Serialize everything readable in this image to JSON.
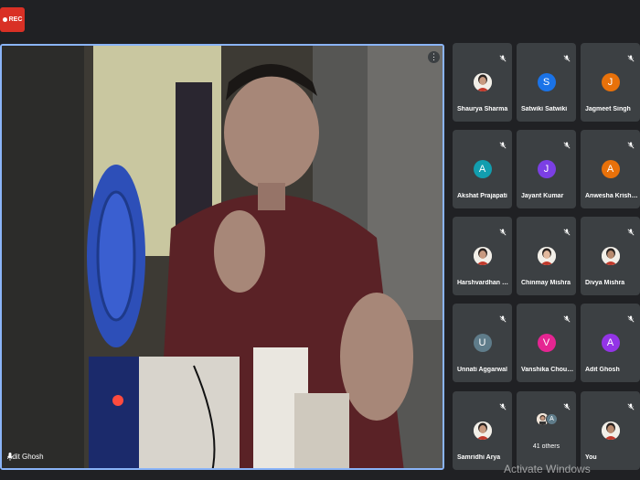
{
  "recording": {
    "label": "REC"
  },
  "main_video": {
    "name": "Adit Ghosh",
    "more_symbol": "⋮"
  },
  "participants": [
    {
      "name": "Shaurya Sharma",
      "initial": "",
      "avatar_color": "",
      "photo": true
    },
    {
      "name": "Satwiki Satwiki",
      "initial": "S",
      "avatar_color": "#1a73e8",
      "photo": false
    },
    {
      "name": "Jagmeet Singh",
      "initial": "J",
      "avatar_color": "#e8710a",
      "photo": false
    },
    {
      "name": "Akshat Prajapati",
      "initial": "A",
      "avatar_color": "#129eaf",
      "photo": false
    },
    {
      "name": "Jayant Kumar",
      "initial": "J",
      "avatar_color": "#7b3fe4",
      "photo": false
    },
    {
      "name": "Anwesha Krishna",
      "initial": "A",
      "avatar_color": "#e8710a",
      "photo": false
    },
    {
      "name": "Harshvardhan Sh...",
      "initial": "",
      "avatar_color": "",
      "photo": true
    },
    {
      "name": "Chinmay Mishra",
      "initial": "",
      "avatar_color": "",
      "photo": true
    },
    {
      "name": "Divya Mishra",
      "initial": "",
      "avatar_color": "",
      "photo": true
    },
    {
      "name": "Unnati Aggarwal",
      "initial": "U",
      "avatar_color": "#5f7c8a",
      "photo": false
    },
    {
      "name": "Vanshika Choudh...",
      "initial": "V",
      "avatar_color": "#e52592",
      "photo": false
    },
    {
      "name": "Adit Ghosh",
      "initial": "A",
      "avatar_color": "#9334e6",
      "photo": false
    },
    {
      "name": "Samridhi Arya",
      "initial": "",
      "avatar_color": "",
      "photo": true
    },
    {
      "name": "41 others",
      "initial": "A",
      "avatar_color": "#5f7c8a",
      "photo": false,
      "group": true
    },
    {
      "name": "You",
      "initial": "",
      "avatar_color": "",
      "photo": true
    }
  ],
  "watermark": "Activate Windows"
}
